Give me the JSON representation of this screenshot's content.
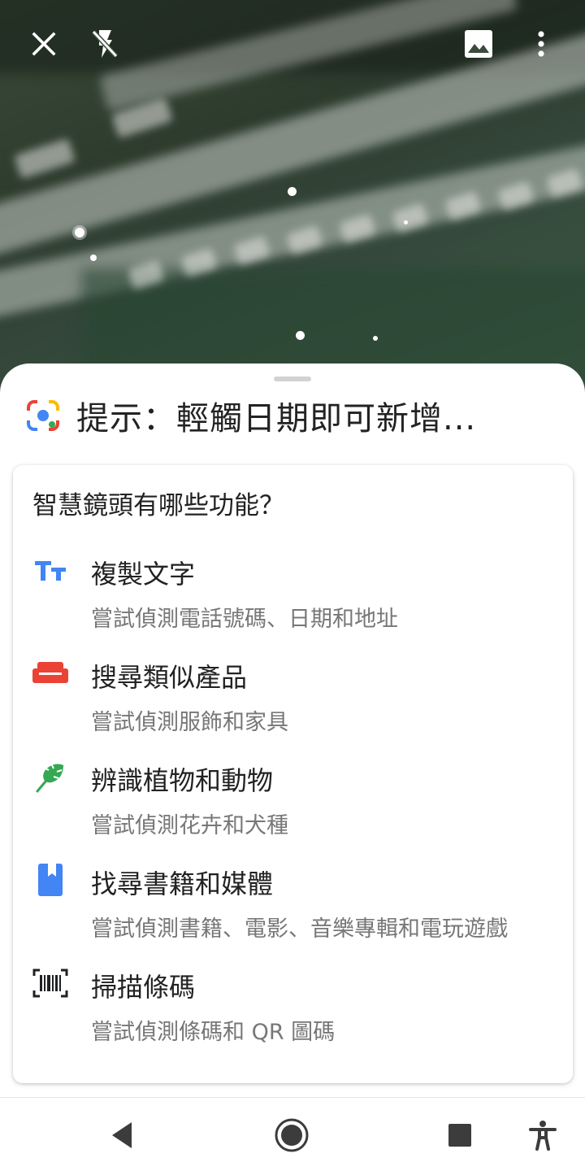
{
  "top_bar": {
    "close_icon": "close-icon",
    "flash_icon": "flash-off-icon",
    "gallery_icon": "image-icon",
    "more_icon": "more-vert-icon"
  },
  "sheet": {
    "hint": "提示：輕觸日期即可新增...",
    "card_title": "智慧鏡頭有哪些功能？",
    "features": [
      {
        "icon": "text-icon",
        "title": "複製文字",
        "desc": "嘗試偵測電話號碼、日期和地址",
        "color": "#4285F4"
      },
      {
        "icon": "sofa-icon",
        "title": "搜尋類似產品",
        "desc": "嘗試偵測服飾和家具",
        "color": "#EA4335"
      },
      {
        "icon": "leaf-icon",
        "title": "辨識植物和動物",
        "desc": "嘗試偵測花卉和犬種",
        "color": "#34A853"
      },
      {
        "icon": "book-icon",
        "title": "找尋書籍和媒體",
        "desc": "嘗試偵測書籍、電影、音樂專輯和電玩遊戲",
        "color": "#4285F4"
      },
      {
        "icon": "barcode-icon",
        "title": "掃描條碼",
        "desc": "嘗試偵測條碼和 QR 圖碼",
        "color": "#202124"
      }
    ]
  },
  "nav": {
    "back_icon": "back-icon",
    "home_icon": "home-icon",
    "recents_icon": "recents-icon",
    "accessibility_icon": "accessibility-icon"
  }
}
